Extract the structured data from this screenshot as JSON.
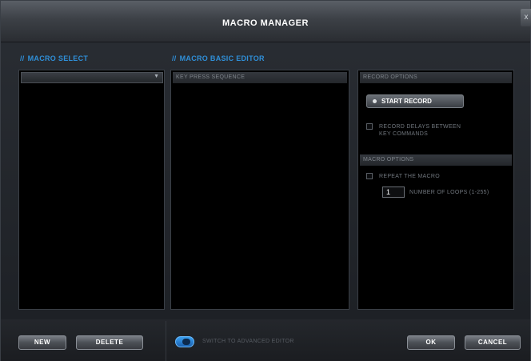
{
  "window": {
    "title": "MACRO MANAGER",
    "close_symbol": "x"
  },
  "macro_select": {
    "section_title": "MACRO SELECT",
    "dropdown_value": "",
    "dropdown_arrow_icon": "chevron-down-icon"
  },
  "basic_editor": {
    "section_title": "MACRO BASIC EDITOR",
    "key_press_header": "KEY PRESS SEQUENCE"
  },
  "record_options": {
    "header": "RECORD OPTIONS",
    "start_record_label": "START RECORD",
    "record_delays_label_line1": "RECORD DELAYS BETWEEN",
    "record_delays_label_line2": "KEY COMMANDS"
  },
  "macro_options": {
    "header": "MACRO OPTIONS",
    "repeat_label": "REPEAT THE MACRO",
    "loops_value": "1",
    "loops_label": "NUMBER OF LOOPS (1-255)"
  },
  "footer": {
    "new_label": "NEW",
    "delete_label": "DELETE",
    "switch_label": "SWITCH TO ADVANCED EDITOR",
    "ok_label": "OK",
    "cancel_label": "CANCEL"
  },
  "colors": {
    "accent": "#2f8fd8",
    "background": "#1c1f24",
    "panel": "#000000"
  }
}
